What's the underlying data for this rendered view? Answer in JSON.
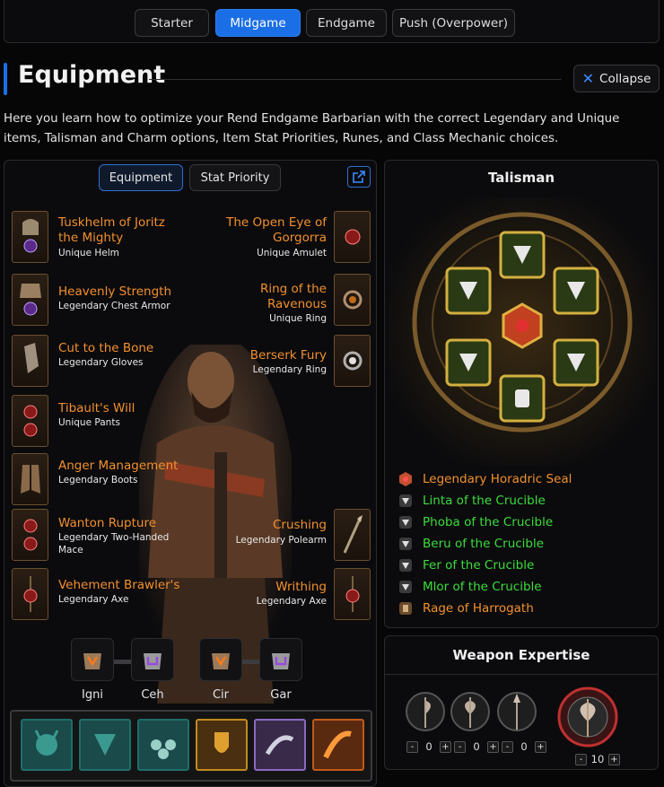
{
  "tabs": [
    "Starter",
    "Midgame",
    "Endgame",
    "Push (Overpower)"
  ],
  "active_tab": "Midgame",
  "section": {
    "title": "Equipment",
    "collapse_label": "Collapse"
  },
  "intro_text": "Here you learn how to optimize your Rend Endgame Barbarian with the correct Legendary and Unique items, Talisman and Charm options, Item Stat Priorities, Runes, and Class Mechanic choices.",
  "subtabs": [
    "Equipment",
    "Stat Priority"
  ],
  "left_items": [
    {
      "name_lines": [
        "Tuskhelm of Joritz",
        "the Mighty"
      ],
      "type_lines": [
        "Unique Helm"
      ],
      "icon": "helm-icon",
      "gem": "purple"
    },
    {
      "name_lines": [
        "Heavenly Strength"
      ],
      "type_lines": [
        "Legendary Chest Armor"
      ],
      "icon": "chest-armor-icon",
      "gem": "purple"
    },
    {
      "name_lines": [
        "Cut to the Bone"
      ],
      "type_lines": [
        "Legendary Gloves"
      ],
      "icon": "gloves-icon",
      "gem": "none"
    },
    {
      "name_lines": [
        "Tibault's Will"
      ],
      "type_lines": [
        "Unique Pants"
      ],
      "icon": "pants-icon",
      "gem": "red"
    },
    {
      "name_lines": [
        "Anger Management"
      ],
      "type_lines": [
        "Legendary Boots"
      ],
      "icon": "boots-icon",
      "gem": "none"
    },
    {
      "name_lines": [
        "Wanton Rupture"
      ],
      "type_lines": [
        "Legendary Two-Handed",
        "Mace"
      ],
      "icon": "mace-icon",
      "gem": "red"
    },
    {
      "name_lines": [
        "Vehement Brawler's"
      ],
      "type_lines": [
        "Legendary Axe"
      ],
      "icon": "axe-icon",
      "gem": "red"
    }
  ],
  "right_items": [
    {
      "name_lines": [
        "The Open Eye of",
        "Gorgorra"
      ],
      "type_lines": [
        "Unique Amulet"
      ],
      "icon": "amulet-icon",
      "gem": "red"
    },
    {
      "name_lines": [
        "Ring of the",
        "Ravenous"
      ],
      "type_lines": [
        "Unique Ring"
      ],
      "icon": "ring-icon",
      "gem": "orange"
    },
    {
      "name_lines": [
        "Berserk Fury"
      ],
      "type_lines": [
        "Legendary Ring"
      ],
      "icon": "ring-icon",
      "gem": "white"
    },
    {
      "name_lines": [
        "Crushing"
      ],
      "type_lines": [
        "Legendary Polearm"
      ],
      "icon": "polearm-icon",
      "gem": "none"
    },
    {
      "name_lines": [
        "Writhing"
      ],
      "type_lines": [
        "Legendary Axe"
      ],
      "icon": "axe-icon",
      "gem": "red"
    }
  ],
  "runes": [
    {
      "label": "Igni",
      "kind": "orange"
    },
    {
      "label": "Ceh",
      "kind": "purple"
    },
    {
      "label": "Cir",
      "kind": "orange"
    },
    {
      "label": "Gar",
      "kind": "purple"
    }
  ],
  "skills": [
    "war-cry-skill-icon",
    "challenging-shout-skill-icon",
    "rallying-cry-skill-icon",
    "iron-skin-skill-icon",
    "horn-skill-icon",
    "rend-skill-icon"
  ],
  "talisman": {
    "title": "Talisman",
    "charms": [
      {
        "label": "Legendary Horadric Seal",
        "color": "#f2902e",
        "icon": "seal-icon"
      },
      {
        "label": "Linta of the Crucible",
        "color": "#3ddc3d",
        "icon": "charm-icon"
      },
      {
        "label": "Phoba of the Crucible",
        "color": "#3ddc3d",
        "icon": "charm-icon"
      },
      {
        "label": "Beru of the Crucible",
        "color": "#3ddc3d",
        "icon": "charm-icon"
      },
      {
        "label": "Fer of the Crucible",
        "color": "#3ddc3d",
        "icon": "charm-icon"
      },
      {
        "label": "Mlor of the Crucible",
        "color": "#3ddc3d",
        "icon": "charm-icon"
      },
      {
        "label": "Rage of Harrogath",
        "color": "#f2902e",
        "icon": "unique-charm-icon"
      }
    ]
  },
  "weapon_expertise": {
    "title": "Weapon Expertise",
    "weapons": [
      {
        "icon": "axe-expertise-icon",
        "value": "0"
      },
      {
        "icon": "two-handed-axe-expertise-icon",
        "value": "0"
      },
      {
        "icon": "polearm-expertise-icon",
        "value": "0"
      }
    ],
    "featured": {
      "icon": "two-handed-axe-expertise-icon",
      "value": "10"
    }
  },
  "colors": {
    "accent": "#1b6fe6",
    "legendary": "#f2902e",
    "set": "#3ddc3d"
  }
}
